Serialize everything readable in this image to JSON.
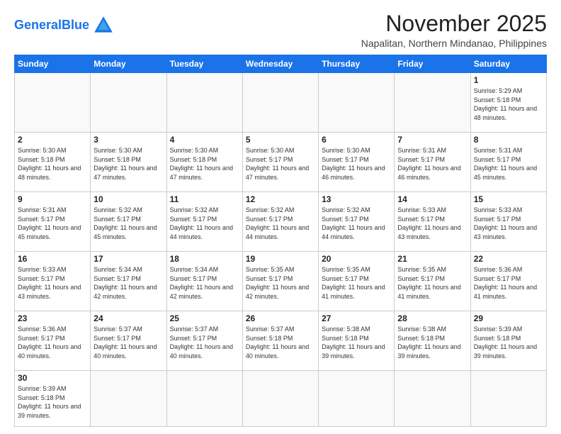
{
  "logo": {
    "text_general": "General",
    "text_blue": "Blue"
  },
  "title": "November 2025",
  "subtitle": "Napalitan, Northern Mindanao, Philippines",
  "weekdays": [
    "Sunday",
    "Monday",
    "Tuesday",
    "Wednesday",
    "Thursday",
    "Friday",
    "Saturday"
  ],
  "weeks": [
    [
      {
        "day": null
      },
      {
        "day": null
      },
      {
        "day": null
      },
      {
        "day": null
      },
      {
        "day": null
      },
      {
        "day": null
      },
      {
        "day": "1",
        "sunrise": "5:29 AM",
        "sunset": "5:18 PM",
        "daylight": "11 hours and 48 minutes."
      }
    ],
    [
      {
        "day": "2",
        "sunrise": "5:30 AM",
        "sunset": "5:18 PM",
        "daylight": "11 hours and 48 minutes."
      },
      {
        "day": "3",
        "sunrise": "5:30 AM",
        "sunset": "5:18 PM",
        "daylight": "11 hours and 47 minutes."
      },
      {
        "day": "4",
        "sunrise": "5:30 AM",
        "sunset": "5:18 PM",
        "daylight": "11 hours and 47 minutes."
      },
      {
        "day": "5",
        "sunrise": "5:30 AM",
        "sunset": "5:17 PM",
        "daylight": "11 hours and 47 minutes."
      },
      {
        "day": "6",
        "sunrise": "5:30 AM",
        "sunset": "5:17 PM",
        "daylight": "11 hours and 46 minutes."
      },
      {
        "day": "7",
        "sunrise": "5:31 AM",
        "sunset": "5:17 PM",
        "daylight": "11 hours and 46 minutes."
      },
      {
        "day": "8",
        "sunrise": "5:31 AM",
        "sunset": "5:17 PM",
        "daylight": "11 hours and 45 minutes."
      }
    ],
    [
      {
        "day": "9",
        "sunrise": "5:31 AM",
        "sunset": "5:17 PM",
        "daylight": "11 hours and 45 minutes."
      },
      {
        "day": "10",
        "sunrise": "5:32 AM",
        "sunset": "5:17 PM",
        "daylight": "11 hours and 45 minutes."
      },
      {
        "day": "11",
        "sunrise": "5:32 AM",
        "sunset": "5:17 PM",
        "daylight": "11 hours and 44 minutes."
      },
      {
        "day": "12",
        "sunrise": "5:32 AM",
        "sunset": "5:17 PM",
        "daylight": "11 hours and 44 minutes."
      },
      {
        "day": "13",
        "sunrise": "5:32 AM",
        "sunset": "5:17 PM",
        "daylight": "11 hours and 44 minutes."
      },
      {
        "day": "14",
        "sunrise": "5:33 AM",
        "sunset": "5:17 PM",
        "daylight": "11 hours and 43 minutes."
      },
      {
        "day": "15",
        "sunrise": "5:33 AM",
        "sunset": "5:17 PM",
        "daylight": "11 hours and 43 minutes."
      }
    ],
    [
      {
        "day": "16",
        "sunrise": "5:33 AM",
        "sunset": "5:17 PM",
        "daylight": "11 hours and 43 minutes."
      },
      {
        "day": "17",
        "sunrise": "5:34 AM",
        "sunset": "5:17 PM",
        "daylight": "11 hours and 42 minutes."
      },
      {
        "day": "18",
        "sunrise": "5:34 AM",
        "sunset": "5:17 PM",
        "daylight": "11 hours and 42 minutes."
      },
      {
        "day": "19",
        "sunrise": "5:35 AM",
        "sunset": "5:17 PM",
        "daylight": "11 hours and 42 minutes."
      },
      {
        "day": "20",
        "sunrise": "5:35 AM",
        "sunset": "5:17 PM",
        "daylight": "11 hours and 41 minutes."
      },
      {
        "day": "21",
        "sunrise": "5:35 AM",
        "sunset": "5:17 PM",
        "daylight": "11 hours and 41 minutes."
      },
      {
        "day": "22",
        "sunrise": "5:36 AM",
        "sunset": "5:17 PM",
        "daylight": "11 hours and 41 minutes."
      }
    ],
    [
      {
        "day": "23",
        "sunrise": "5:36 AM",
        "sunset": "5:17 PM",
        "daylight": "11 hours and 40 minutes."
      },
      {
        "day": "24",
        "sunrise": "5:37 AM",
        "sunset": "5:17 PM",
        "daylight": "11 hours and 40 minutes."
      },
      {
        "day": "25",
        "sunrise": "5:37 AM",
        "sunset": "5:17 PM",
        "daylight": "11 hours and 40 minutes."
      },
      {
        "day": "26",
        "sunrise": "5:37 AM",
        "sunset": "5:18 PM",
        "daylight": "11 hours and 40 minutes."
      },
      {
        "day": "27",
        "sunrise": "5:38 AM",
        "sunset": "5:18 PM",
        "daylight": "11 hours and 39 minutes."
      },
      {
        "day": "28",
        "sunrise": "5:38 AM",
        "sunset": "5:18 PM",
        "daylight": "11 hours and 39 minutes."
      },
      {
        "day": "29",
        "sunrise": "5:39 AM",
        "sunset": "5:18 PM",
        "daylight": "11 hours and 39 minutes."
      }
    ],
    [
      {
        "day": "30",
        "sunrise": "5:39 AM",
        "sunset": "5:18 PM",
        "daylight": "11 hours and 39 minutes."
      },
      {
        "day": null
      },
      {
        "day": null
      },
      {
        "day": null
      },
      {
        "day": null
      },
      {
        "day": null
      },
      {
        "day": null
      }
    ]
  ]
}
